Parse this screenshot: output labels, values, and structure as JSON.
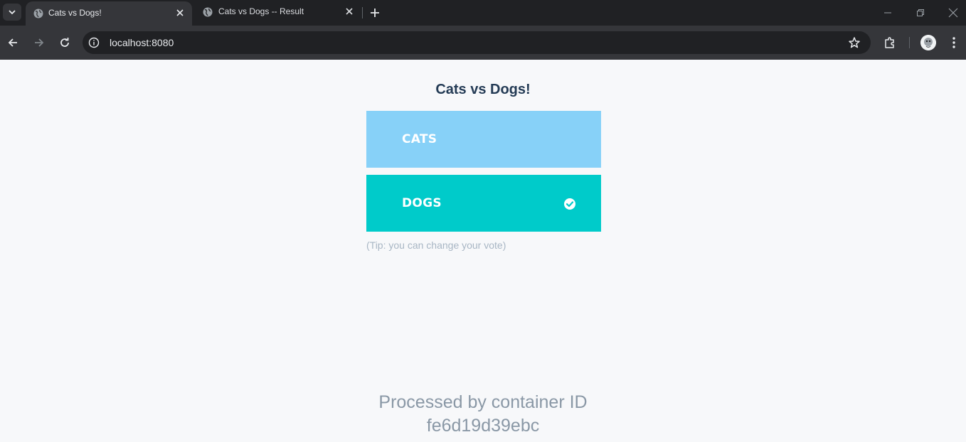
{
  "browser": {
    "tabs": [
      {
        "title": "Cats vs Dogs!",
        "active": true
      },
      {
        "title": "Cats vs Dogs -- Result",
        "active": false
      }
    ],
    "url": "localhost:8080"
  },
  "page": {
    "title": "Cats vs Dogs!",
    "options": [
      {
        "label": "CATS",
        "color": "#87d1f8",
        "selected": false
      },
      {
        "label": "DOGS",
        "color": "#00cbca",
        "selected": true
      }
    ],
    "tip": "(Tip: you can change your vote)",
    "footer_line1": "Processed by container ID",
    "footer_line2": "fe6d19d39ebc"
  },
  "icons": {
    "tab_favicon": "globe-icon",
    "selected_marker": "check-circle-icon"
  }
}
